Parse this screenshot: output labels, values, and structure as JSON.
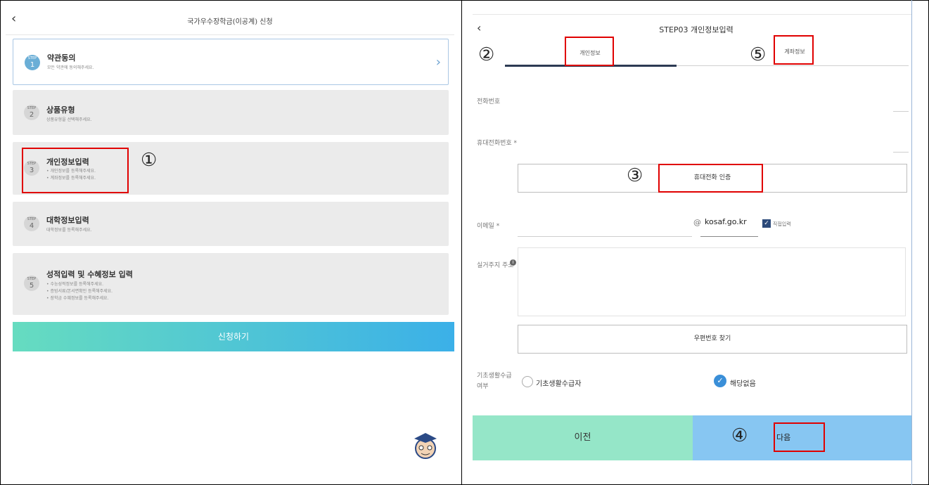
{
  "left": {
    "header": {
      "back_icon": "chevron-left-icon",
      "title": "국가우수장학금(이공계) 신청"
    },
    "steps": [
      {
        "step_word": "STEP",
        "num": "1",
        "title": "약관동의",
        "desc": [
          "모든 약관에 동의해주세요."
        ]
      },
      {
        "step_word": "STEP",
        "num": "2",
        "title": "상품유형",
        "desc": [
          "상품유형을 선택해주세요."
        ]
      },
      {
        "step_word": "STEP",
        "num": "3",
        "title": "개인정보입력",
        "desc": [
          "• 개인정보를 등록해주세요.",
          "• 계좌정보를 등록해주세요."
        ]
      },
      {
        "step_word": "STEP",
        "num": "4",
        "title": "대학정보입력",
        "desc": [
          "대학정보를 등록해주세요."
        ]
      },
      {
        "step_word": "STEP",
        "num": "5",
        "title": "성적입력 및 수혜정보 입력",
        "desc": [
          "• 수능성적정보를 등록해주세요.",
          "• 증빙서류/본서면확인 등록해주세요.",
          "• 장학금 수혜정보를 등록해주세요."
        ]
      }
    ],
    "apply_button": "신청하기",
    "mascot_icon": "mascot-icon"
  },
  "right": {
    "header": {
      "back_icon": "chevron-left-icon",
      "title": "STEP03 개인정보입력"
    },
    "tabs": [
      "개인정보",
      "계좌정보"
    ],
    "phone_label": "전화번호",
    "mobile_label": "휴대전화번호 *",
    "verify_button": "휴대전화 인증",
    "email_label": "이메일 *",
    "email_at": "@",
    "email_domain": "kosaf.go.kr",
    "direct_input_label": "직접입력",
    "address_label": "실거주지 주소",
    "zip_button": "우편번호 찾기",
    "basic_label_1": "기초생활수급",
    "basic_label_2": "여부",
    "radio_options": [
      "기초생활수급자",
      "해당없음"
    ],
    "prev_button": "이전",
    "next_button": "다음"
  },
  "annotations": [
    "①",
    "②",
    "③",
    "④",
    "⑤"
  ],
  "colors": {
    "accent_blue": "#3a8fd8",
    "annotation_red": "#e00000",
    "apply_gradient_start": "#66dcc0",
    "apply_gradient_end": "#3bb0e8",
    "prev_green": "#95e6c8",
    "next_blue": "#87c6f2"
  }
}
